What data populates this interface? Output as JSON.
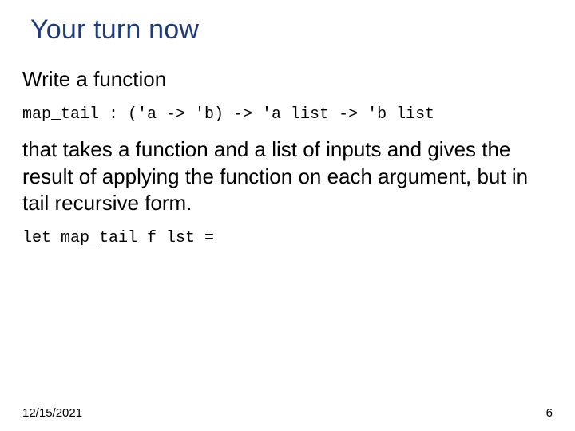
{
  "title": "Your turn now",
  "p1": "Write a function",
  "sig": "map_tail : ('a -> 'b) -> 'a list -> 'b list",
  "p2": "that takes a function and a list of inputs and gives the result of applying the function on each argument, but in tail recursive form.",
  "code": "let map_tail f lst =",
  "date": "12/15/2021",
  "page": "6"
}
